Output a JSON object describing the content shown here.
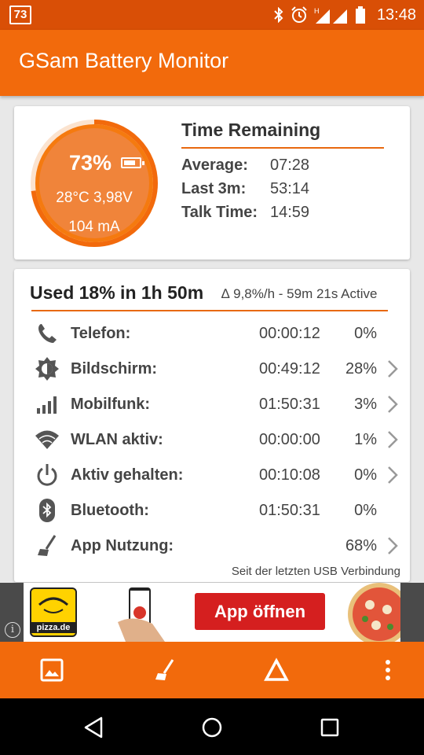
{
  "status_bar": {
    "notification": "73",
    "time": "13:48",
    "signal_tag": "H",
    "icons": [
      "bluetooth-icon",
      "alarm-icon",
      "signal-icon",
      "battery-icon"
    ]
  },
  "app_bar": {
    "title": "GSam Battery Monitor"
  },
  "battery": {
    "level_percent": "73%",
    "level_fraction": 0.73,
    "temp_voltage": "28°C  3,98V",
    "current": "104 mA"
  },
  "time_remaining": {
    "title": "Time Remaining",
    "rows": [
      {
        "label": "Average:",
        "value": "07:28"
      },
      {
        "label": "Last 3m:",
        "value": "53:14"
      },
      {
        "label": "Talk Time:",
        "value": "14:59"
      }
    ]
  },
  "usage": {
    "title": "Used 18% in 1h 50m",
    "subtitle": "∆ 9,8%/h - 59m 21s Active",
    "rows": [
      {
        "icon": "phone-icon",
        "name": "Telefon:",
        "duration": "00:00:12",
        "percent": "0%",
        "chevron": false
      },
      {
        "icon": "screen-brightness-icon",
        "name": "Bildschirm:",
        "duration": "00:49:12",
        "percent": "28%",
        "chevron": true
      },
      {
        "icon": "cell-signal-icon",
        "name": "Mobilfunk:",
        "duration": "01:50:31",
        "percent": "3%",
        "chevron": true
      },
      {
        "icon": "wifi-icon",
        "name": "WLAN aktiv:",
        "duration": "00:00:00",
        "percent": "1%",
        "chevron": true
      },
      {
        "icon": "power-icon",
        "name": "Aktiv gehalten:",
        "duration": "00:10:08",
        "percent": "0%",
        "chevron": true
      },
      {
        "icon": "bluetooth-icon",
        "name": "Bluetooth:",
        "duration": "01:50:31",
        "percent": "0%",
        "chevron": false
      },
      {
        "icon": "broom-icon",
        "name": "App Nutzung:",
        "duration": "",
        "percent": "68%",
        "chevron": true
      }
    ],
    "footnote": "Seit der letzten USB Verbindung"
  },
  "ad": {
    "brand": "pizza.de",
    "button_label": "App öffnen",
    "info_glyph": "i"
  },
  "toolbar": {
    "items": [
      "image-icon",
      "broom-icon",
      "delta-icon",
      "more-vert-icon"
    ]
  },
  "colors": {
    "primary": "#f26a0c",
    "primary_dark": "#d94f06",
    "accent_line": "#e8690f",
    "ad_button": "#d51f1f"
  }
}
